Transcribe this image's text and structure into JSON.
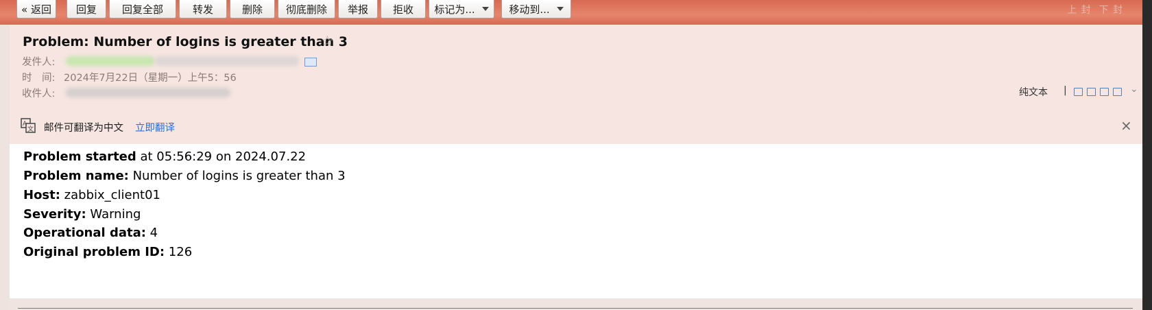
{
  "toolbar": {
    "back": "« 返回",
    "reply": "回复",
    "reply_all": "回复全部",
    "forward": "转发",
    "delete": "删除",
    "delete_permanently": "彻底删除",
    "report": "举报",
    "reject": "拒收",
    "mark_as": "标记为...",
    "move_to": "移动到...",
    "nav_prev": "上",
    "nav_prev2": "封",
    "nav_next": "下",
    "nav_next2": "封"
  },
  "email": {
    "subject": "Problem: Number of logins is greater than 3",
    "star_icon": "star-outline-icon",
    "from_label": "发件人:",
    "time_label": "时　间:",
    "time_value": "2024年7月22日（星期一）上午5：56",
    "to_label": "收件人:",
    "plain_text_label": "纯文本",
    "separator": "|"
  },
  "translate_bar": {
    "message": "邮件可翻译为中文",
    "action": "立即翻译",
    "close": "×"
  },
  "body_lines": [
    {
      "bold": "Problem started",
      "text": " at 05:56:29 on 2024.07.22"
    },
    {
      "bold": "Problem name:",
      "text": " Number of logins is greater than 3"
    },
    {
      "bold": "Host:",
      "text": " zabbix_client01"
    },
    {
      "bold": "Severity:",
      "text": " Warning"
    },
    {
      "bold": "Operational data:",
      "text": " 4"
    },
    {
      "bold": "Original problem ID:",
      "text": " 126"
    }
  ],
  "colors": {
    "toolbar": "#e07a62",
    "header_bg": "#f6e5e1",
    "link": "#2b6fd6"
  }
}
